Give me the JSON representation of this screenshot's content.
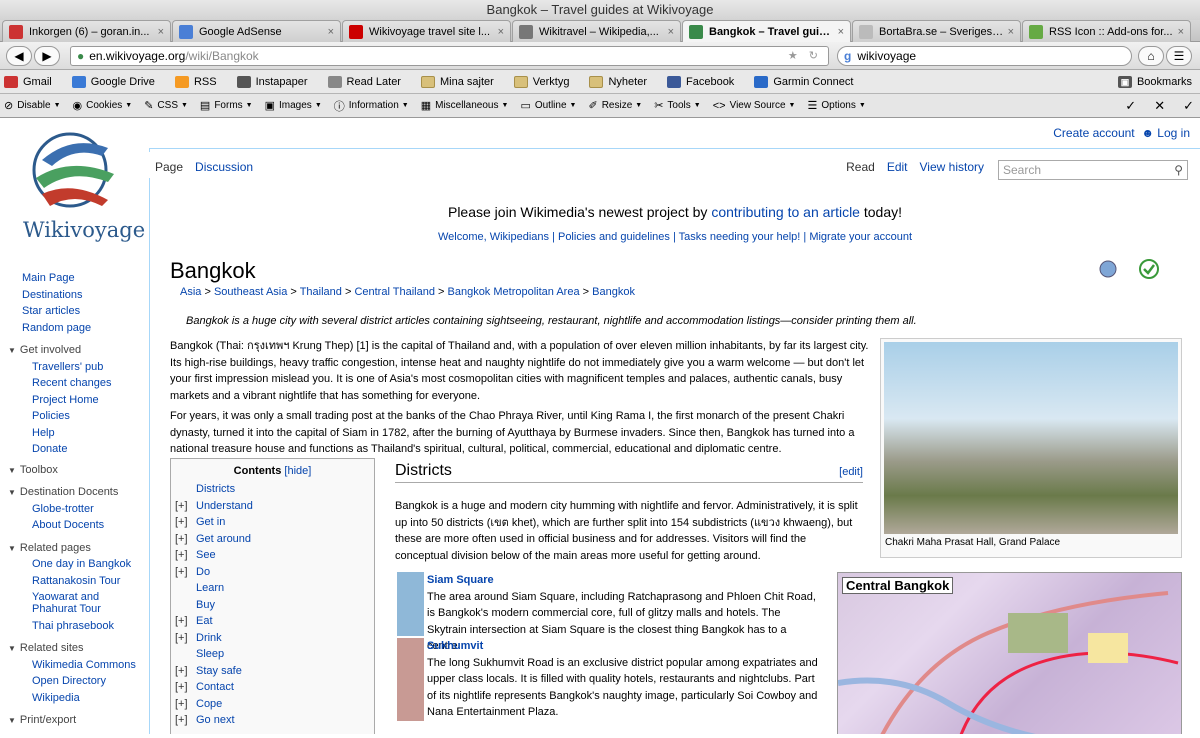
{
  "window": {
    "title": "Bangkok – Travel guides at Wikivoyage"
  },
  "tabs": [
    {
      "label": "Inkorgen (6) – goran.in...",
      "icon": "gmail-icon",
      "color": "#c33"
    },
    {
      "label": "Google AdSense",
      "icon": "google-icon",
      "color": "#4a7fd6"
    },
    {
      "label": "Wikivoyage travel site l...",
      "icon": "cnn-icon",
      "color": "#c00"
    },
    {
      "label": "Wikitravel – Wikipedia,...",
      "icon": "wikipedia-icon",
      "color": "#777"
    },
    {
      "label": "Bangkok – Travel guid...",
      "icon": "wikivoyage-icon",
      "color": "#3a8a4a"
    },
    {
      "label": "BortaBra.se – Sveriges ...",
      "icon": "page-icon",
      "color": "#bbb"
    },
    {
      "label": "RSS Icon :: Add-ons for...",
      "icon": "puzzle-icon",
      "color": "#6a4"
    }
  ],
  "nav": {
    "url_host": "en.wikivoyage.org",
    "url_path": "/wiki/Bangkok",
    "search_value": "wikivoyage"
  },
  "bookmarks": [
    "Gmail",
    "Google Drive",
    "RSS",
    "Instapaper",
    "Read Later",
    "Mina sajter",
    "Verktyg",
    "Nyheter",
    "Facebook",
    "Garmin Connect"
  ],
  "bookmarks_right": "Bookmarks",
  "devtools": [
    "Disable",
    "Cookies",
    "CSS",
    "Forms",
    "Images",
    "Information",
    "Miscellaneous",
    "Outline",
    "Resize",
    "Tools",
    "View Source",
    "Options"
  ],
  "site": {
    "name": "Wikivoyage"
  },
  "sidebar": {
    "main": [
      "Main Page",
      "Destinations",
      "Star articles",
      "Random page"
    ],
    "get_involved": {
      "heading": "Get involved",
      "items": [
        "Travellers' pub",
        "Recent changes",
        "Project Home",
        "Policies",
        "Help",
        "Donate"
      ]
    },
    "toolbox": "Toolbox",
    "docents": {
      "heading": "Destination Docents",
      "items": [
        "Globe-trotter",
        "About Docents"
      ]
    },
    "related_pages": {
      "heading": "Related pages",
      "items": [
        "One day in Bangkok",
        "Rattanakosin Tour",
        "Yaowarat and",
        "Phahurat Tour",
        "Thai phrasebook"
      ]
    },
    "related_sites": {
      "heading": "Related sites",
      "items": [
        "Wikimedia Commons",
        "Open Directory",
        "Wikipedia"
      ]
    },
    "print": "Print/export"
  },
  "user": {
    "create": "Create account",
    "login": "Log in"
  },
  "page_tabs": {
    "page": "Page",
    "discussion": "Discussion",
    "read": "Read",
    "edit": "Edit",
    "history": "View history",
    "search_placeholder": "Search"
  },
  "banner": {
    "pre": "Please join Wikimedia's newest project by ",
    "link": "contributing to an article",
    "post": " today!",
    "links": "Welcome, Wikipedians | Policies and guidelines | Tasks needing your help! | Migrate your account"
  },
  "article": {
    "title": "Bangkok",
    "breadcrumbs": [
      "Asia",
      "Southeast Asia",
      "Thailand",
      "Central Thailand",
      "Bangkok Metropolitan Area",
      "Bangkok"
    ],
    "lede": "Bangkok is a huge city with several district articles containing sightseeing, restaurant, nightlife and accommodation listings—consider printing them all.",
    "p1": "Bangkok (Thai: กรุงเทพฯ Krung Thep) [1] is the capital of Thailand and, with a population of over eleven million inhabitants, by far its largest city. Its high-rise buildings, heavy traffic congestion, intense heat and naughty nightlife do not immediately give you a warm welcome — but don't let your first impression mislead you. It is one of Asia's most cosmopolitan cities with magnificent temples and palaces, authentic canals, busy markets and a vibrant nightlife that has something for everyone.",
    "p2": "For years, it was only a small trading post at the banks of the Chao Phraya River, until King Rama I, the first monarch of the present Chakri dynasty, turned it into the capital of Siam in 1782, after the burning of Ayutthaya by Burmese invaders. Since then, Bangkok has turned into a national treasure house and functions as Thailand's spiritual, cultural, political, commercial, educational and diplomatic centre.",
    "photo_caption": "Chakri Maha Prasat Hall, Grand Palace",
    "toc_title": "Contents",
    "toc_hide": "[hide]",
    "toc": [
      [
        "",
        "Districts"
      ],
      [
        "[+]",
        "Understand"
      ],
      [
        "[+]",
        "Get in"
      ],
      [
        "[+]",
        "Get around"
      ],
      [
        "[+]",
        "See"
      ],
      [
        "[+]",
        "Do"
      ],
      [
        "",
        "Learn"
      ],
      [
        "",
        "Buy"
      ],
      [
        "[+]",
        "Eat"
      ],
      [
        "[+]",
        "Drink"
      ],
      [
        "",
        "Sleep"
      ],
      [
        "[+]",
        "Stay safe"
      ],
      [
        "[+]",
        "Contact"
      ],
      [
        "[+]",
        "Cope"
      ],
      [
        "[+]",
        "Go next"
      ]
    ],
    "districts_heading": "Districts",
    "edit": "[edit]",
    "districts_text": "Bangkok is a huge and modern city humming with nightlife and fervor. Administratively, it is split up into 50 districts (เขต khet), which are further split into 154 subdistricts (แขวง khwaeng), but these are more often used in official business and for addresses. Visitors will find the conceptual division below of the main areas more useful for getting around.",
    "districts": [
      {
        "name": "Siam Square",
        "color": "#8fb8d8",
        "text": "The area around Siam Square, including Ratchaprasong and Phloen Chit Road, is Bangkok's modern commercial core, full of glitzy malls and hotels. The Skytrain intersection at Siam Square is the closest thing Bangkok has to a centre."
      },
      {
        "name": "Sukhumvit",
        "color": "#c89a94",
        "text": "The long Sukhumvit Road is an exclusive district popular among expatriates and upper class locals. It is filled with quality hotels, restaurants and nightclubs. Part of its nightlife represents Bangkok's naughty image, particularly Soi Cowboy and Nana Entertainment Plaza."
      }
    ],
    "map_title": "Central Bangkok"
  }
}
